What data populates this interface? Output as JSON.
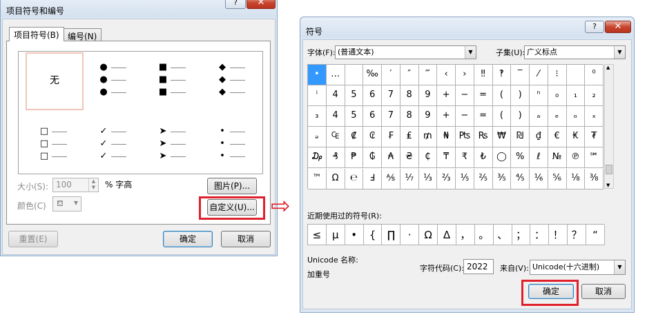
{
  "dialog_bullets": {
    "title": "项目符号和编号",
    "help_label": "?",
    "close_label": "✕",
    "tabs": [
      "项目符号(B)",
      "编号(N)"
    ],
    "gallery_none_label": "无",
    "bullet_markers": [
      "●",
      "■",
      "◆",
      "□",
      "✓",
      "➤",
      "•"
    ],
    "size_label": "大小(S):",
    "size_value": "100",
    "size_unit": "% 字高",
    "color_label": "颜色(C)",
    "picture_button": "图片(P)...",
    "custom_button": "自定义(U)...",
    "reset_button": "重置(E)",
    "ok_button": "确定",
    "cancel_button": "取消"
  },
  "arrow_label": "⇨",
  "dialog_symbol": {
    "title": "符号",
    "help_label": "?",
    "close_label": "✕",
    "font_label": "字体(F):",
    "font_value": "(普通文本)",
    "subset_label": "子集(U):",
    "subset_value": "广义标点",
    "grid_rows": [
      [
        "•",
        "…",
        "",
        "‰",
        "′",
        "″",
        "‴",
        "‹",
        "›",
        "‼",
        "‽",
        "‾",
        "⁄",
        "⁝",
        "",
        "⁰"
      ],
      [
        "ⁱ",
        "4",
        "5",
        "6",
        "7",
        "8",
        "9",
        "+",
        "−",
        "=",
        "(",
        ")",
        "ⁿ",
        "₀",
        "₁",
        "₂"
      ],
      [
        "₃",
        "4",
        "5",
        "6",
        "7",
        "8",
        "9",
        "+",
        "−",
        "=",
        "(",
        ")",
        "ₐ",
        "ₑ",
        "ₒ",
        "ₓ"
      ],
      [
        "ₔ",
        "₠",
        "₡",
        "₢",
        "₣",
        "₤",
        "₥",
        "₦",
        "₧",
        "₨",
        "₩",
        "₪",
        "₫",
        "€",
        "₭",
        "₮"
      ],
      [
        "₯",
        "₰",
        "₱",
        "₲",
        "₳",
        "₴",
        "₵",
        "₸",
        "₹",
        "₺",
        "◯",
        "%",
        "ℓ",
        "№",
        "℗",
        "℠"
      ],
      [
        "™",
        "Ω",
        "℮",
        "Ⅎ",
        "⅍",
        "⅐",
        "⅓",
        "⅔",
        "⅕",
        "⅖",
        "⅗",
        "⅘",
        "⅙",
        "⅚",
        "⅛",
        "⅜"
      ]
    ],
    "recent_label": "近期使用过的符号(R):",
    "recent_symbols": [
      "≤",
      "μ",
      "•",
      "{",
      "∏",
      "·",
      "Ω",
      "Δ",
      "，",
      "。",
      "、",
      "；",
      "：",
      "！",
      "？",
      "“"
    ],
    "unicode_name_label": "Unicode 名称:",
    "unicode_name_value": "加重号",
    "char_code_label": "字符代码(C):",
    "char_code_value": "2022",
    "from_label": "来自(V):",
    "from_value": "Unicode(十六进制)",
    "ok_button": "确定",
    "cancel_button": "取消"
  }
}
